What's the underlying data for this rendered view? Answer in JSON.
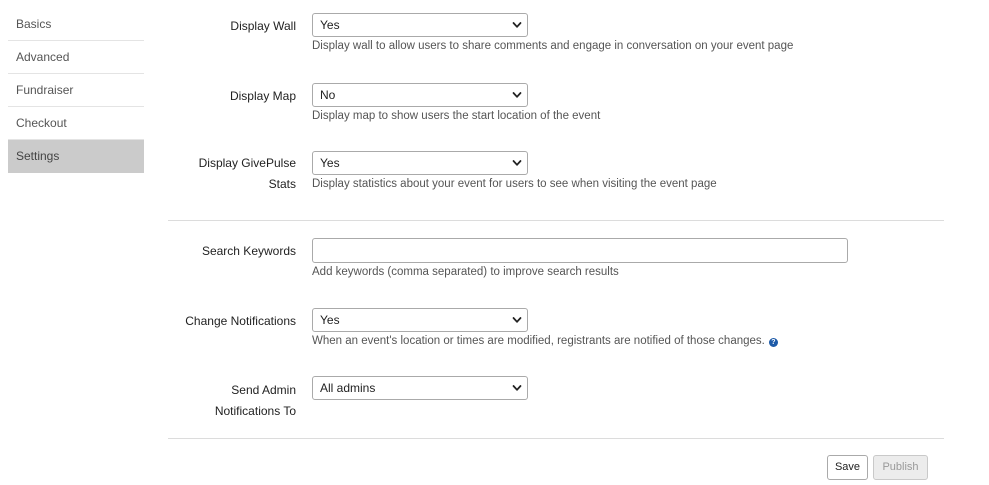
{
  "sidebar": {
    "items": [
      {
        "label": "Basics"
      },
      {
        "label": "Advanced"
      },
      {
        "label": "Fundraiser"
      },
      {
        "label": "Checkout"
      },
      {
        "label": "Settings"
      }
    ]
  },
  "settings": {
    "display_wall": {
      "label": "Display Wall",
      "value": "Yes",
      "help": "Display wall to allow users to share comments and engage in conversation on your event page"
    },
    "display_map": {
      "label": "Display Map",
      "value": "No",
      "help": "Display map to show users the start location of the event"
    },
    "display_stats": {
      "label": "Display GivePulse Stats",
      "value": "Yes",
      "help": "Display statistics about your event for users to see when visiting the event page"
    },
    "search_keywords": {
      "label": "Search Keywords",
      "value": "",
      "help": "Add keywords (comma separated) to improve search results"
    },
    "change_notifications": {
      "label": "Change Notifications",
      "value": "Yes",
      "help": "When an event's location or times are modified, registrants are notified of those changes.",
      "help_icon": "?"
    },
    "admin_notifications": {
      "label_line1": "Send Admin",
      "label_line2": "Notifications To",
      "value": "All admins"
    }
  },
  "actions": {
    "save_label": "Save",
    "publish_label": "Publish"
  },
  "colors": {
    "active_nav_bg": "#cbcbcb",
    "help_icon": "#1d5aa8"
  }
}
